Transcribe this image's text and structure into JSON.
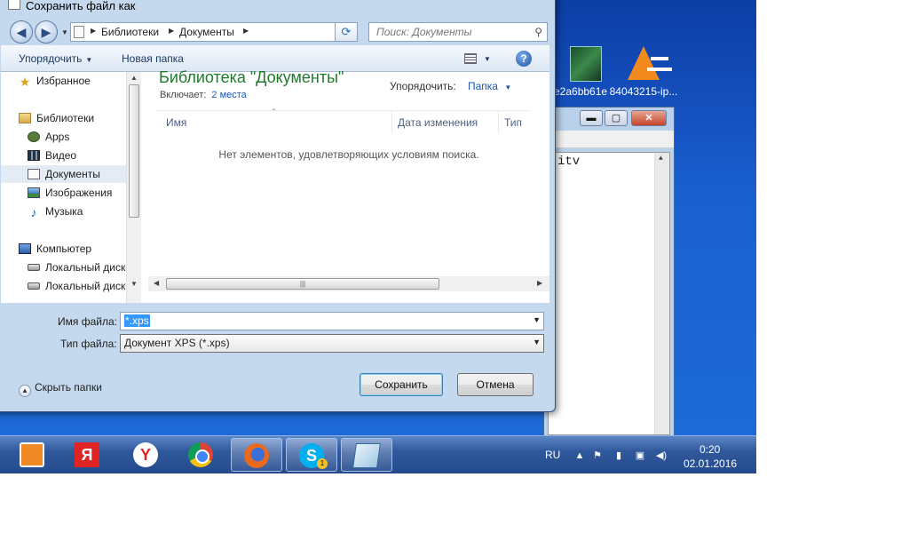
{
  "dialog": {
    "title": "Сохранить файл как",
    "breadcrumb": [
      "Библиотеки",
      "Документы"
    ],
    "search_placeholder": "Поиск: Документы",
    "toolbar": {
      "organize": "Упорядочить",
      "new_folder": "Новая папка"
    },
    "nav": {
      "favorites": "Избранное",
      "libraries": "Библиотеки",
      "library_items": [
        "Apps",
        "Видео",
        "Документы",
        "Изображения",
        "Музыка"
      ],
      "computer": "Компьютер",
      "drives": [
        "Локальный диск",
        "Локальный диск"
      ]
    },
    "content": {
      "library_title": "Библиотека \"Документы\"",
      "includes_label": "Включает:",
      "includes_link": "2 места",
      "arrange_label": "Упорядочить:",
      "arrange_value": "Папка",
      "columns": [
        "Имя",
        "Дата изменения",
        "Тип"
      ],
      "empty_message": "Нет элементов, удовлетворяющих условиям поиска."
    },
    "filename_label": "Имя файла:",
    "filename_value": "*.xps",
    "filetype_label": "Тип файла:",
    "filetype_value": "Документ XPS (*.xps)",
    "hide_folders": "Скрыть папки",
    "save_button": "Сохранить",
    "cancel_button": "Отмена"
  },
  "desktop": {
    "icons": [
      {
        "label": "e2a6bb61e",
        "icon": "image-file-icon"
      },
      {
        "label": "84043215-ip...",
        "icon": "vlc-cone-icon"
      }
    ],
    "background_window_text": "itv"
  },
  "taskbar": {
    "apps": [
      "media-player-icon",
      "yandex-icon",
      "yandex-browser-icon",
      "chrome-icon",
      "firefox-icon",
      "skype-icon",
      "notepad-icon"
    ],
    "skype_badge": "1",
    "language": "RU",
    "time": "0:20",
    "date": "02.01.2016"
  }
}
